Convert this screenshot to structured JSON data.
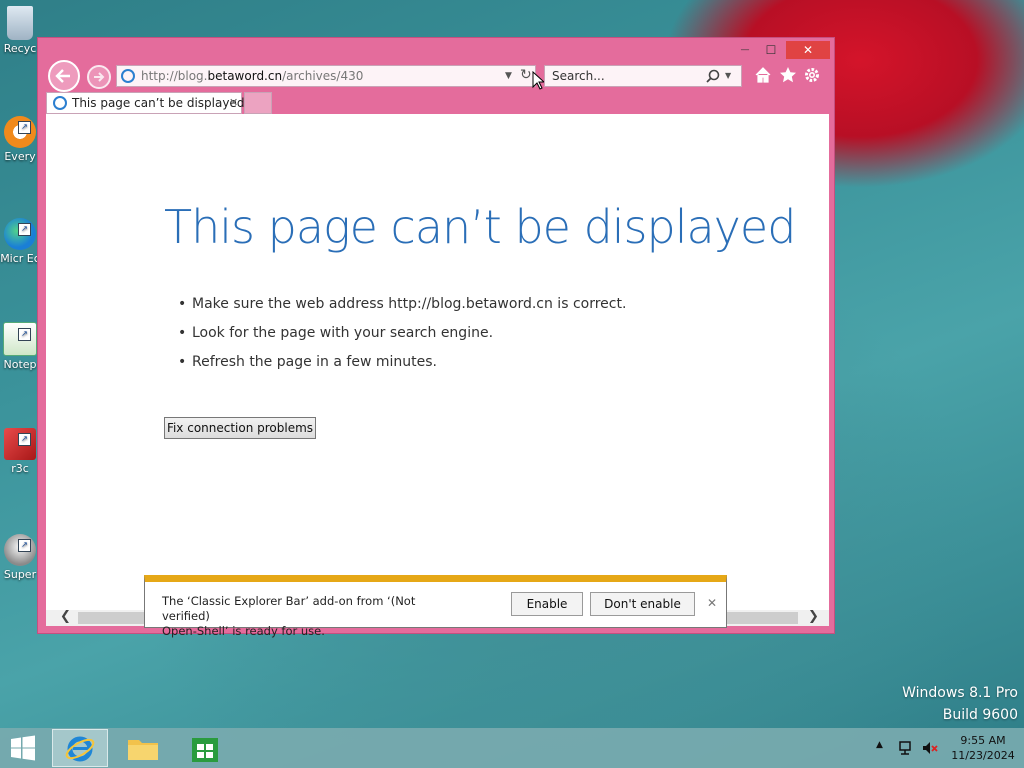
{
  "desktop": {
    "icons": [
      {
        "label": "Recyc"
      },
      {
        "label": "Every"
      },
      {
        "label": "Micr Ec"
      },
      {
        "label": "Notep"
      },
      {
        "label": "r3c"
      },
      {
        "label": "Super"
      }
    ],
    "watermark": {
      "line1": "Windows 8.1 Pro",
      "line2": "Build 9600"
    }
  },
  "browser": {
    "window_controls": {
      "minimize": "—",
      "maximize": "☐",
      "close": "✕"
    },
    "address": {
      "prefix": "http://blog.",
      "domain": "betaword.cn",
      "path": "/archives/430"
    },
    "search": {
      "placeholder": "Search..."
    },
    "tab": {
      "title": "This page can’t be displayed",
      "close": "✕"
    },
    "page": {
      "title": "This page can’t be displayed",
      "bullets": [
        "Make sure the web address http://blog.betaword.cn is correct.",
        "Look for the page with your search engine.",
        "Refresh the page in a few minutes."
      ],
      "fix_button": "Fix connection problems"
    },
    "notification": {
      "line1": "The ‘Classic Explorer Bar’ add-on from ‘(Not verified)",
      "line2": "Open-Shell’ is ready for use.",
      "enable": "Enable",
      "dont_enable": "Don't enable",
      "close": "✕"
    }
  },
  "taskbar": {
    "clock": {
      "time": "9:55 AM",
      "date": "11/23/2024"
    }
  },
  "colors": {
    "frame": "#e46c9c",
    "title_blue": "#2a6eb7",
    "notif_bar": "#e6a817"
  }
}
